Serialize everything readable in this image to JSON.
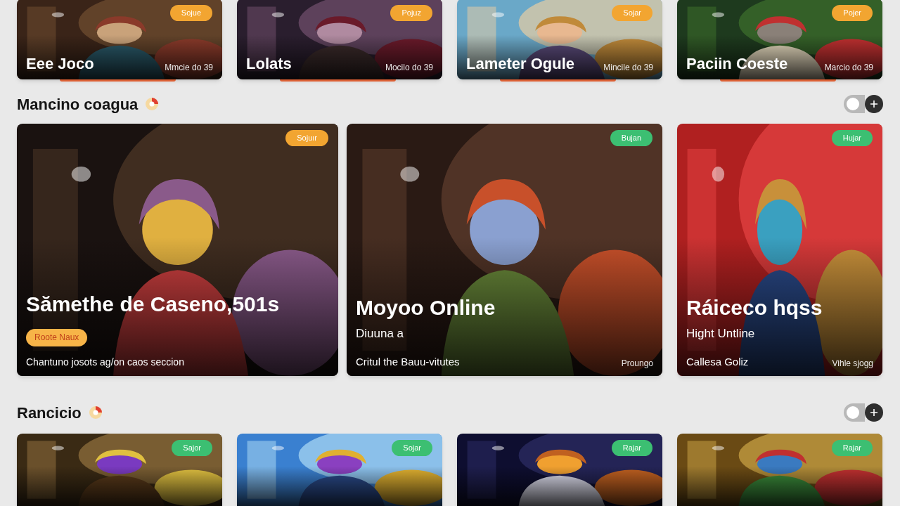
{
  "top_games": [
    {
      "title": "Eee Joco",
      "meta": "Mmcie do 39",
      "badge": {
        "label": "Sojue",
        "color": "#f2a531"
      }
    },
    {
      "title": "Lolats",
      "meta": "Mocilo do 39",
      "badge": {
        "label": "Pojuz",
        "color": "#f2a531"
      }
    },
    {
      "title": "Lameter Ogule",
      "meta": "Mincile do 39",
      "badge": {
        "label": "Sojar",
        "color": "#f2a531"
      }
    },
    {
      "title": "Paciin Coeste",
      "meta": "Marcio do 39",
      "badge": {
        "label": "Pojer",
        "color": "#f2a531"
      }
    }
  ],
  "sections": [
    {
      "title": "Mancino coagua",
      "toggle": {
        "on": false
      },
      "games": [
        {
          "title": "Sămethe de Caseno,501s",
          "tag": "Roote Naux",
          "description": "Chantuno josots ag/on caos seccion",
          "badge": {
            "label": "Sojuır",
            "color": "#f2a531"
          }
        },
        {
          "title": "Moyoo Online",
          "subtitle": "Diuuna a",
          "footer_left": "Critul the Bauu-vitutes",
          "footer_right": "Proungo",
          "badge": {
            "label": "Bujan",
            "color": "#3cbf72"
          }
        },
        {
          "title": "Ráiceco hqss",
          "subtitle": "Hight Untline",
          "footer_left": "Callesa Goliz",
          "footer_right": "Vihle sjogg",
          "badge": {
            "label": "Hujar",
            "color": "#3cbf72"
          }
        }
      ]
    },
    {
      "title": "Rancicio",
      "toggle": {
        "on": false
      },
      "games": [
        {
          "badge": {
            "label": "Sajor",
            "color": "#3cbf72"
          }
        },
        {
          "badge": {
            "label": "Sojar",
            "color": "#3cbf72"
          }
        },
        {
          "badge": {
            "label": "Rajar",
            "color": "#3cbf72"
          }
        },
        {
          "badge": {
            "label": "Rajar",
            "color": "#3cbf72"
          }
        }
      ]
    }
  ]
}
